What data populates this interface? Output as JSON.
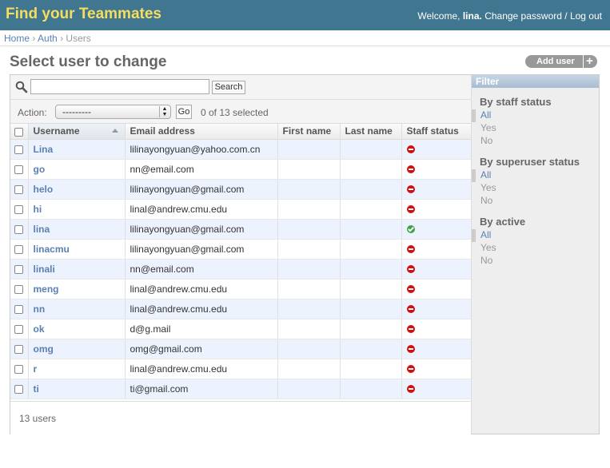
{
  "header": {
    "branding": "Find your Teammates",
    "welcome_prefix": "Welcome,",
    "username": "lina.",
    "change_password": "Change password",
    "separator": "/",
    "logout": "Log out"
  },
  "breadcrumbs": {
    "home": "Home",
    "sep": "›",
    "auth": "Auth",
    "current": "Users"
  },
  "page": {
    "title": "Select user to change",
    "add_user": "Add user"
  },
  "search": {
    "value": "",
    "placeholder": "",
    "button": "Search"
  },
  "actions": {
    "label": "Action:",
    "selected_option": "---------",
    "go": "Go",
    "counter": "0 of 13 selected"
  },
  "table": {
    "columns": [
      "Username",
      "Email address",
      "First name",
      "Last name",
      "Staff status"
    ],
    "rows": [
      {
        "username": "Lina",
        "email": "lilinayongyuan@yahoo.com.cn",
        "first_name": "",
        "last_name": "",
        "staff": false
      },
      {
        "username": "go",
        "email": "nn@email.com",
        "first_name": "",
        "last_name": "",
        "staff": false
      },
      {
        "username": "helo",
        "email": "lilinayongyuan@gmail.com",
        "first_name": "",
        "last_name": "",
        "staff": false
      },
      {
        "username": "hi",
        "email": "linal@andrew.cmu.edu",
        "first_name": "",
        "last_name": "",
        "staff": false
      },
      {
        "username": "lina",
        "email": "lilinayongyuan@gmail.com",
        "first_name": "",
        "last_name": "",
        "staff": true
      },
      {
        "username": "linacmu",
        "email": "lilinayongyuan@gmail.com",
        "first_name": "",
        "last_name": "",
        "staff": false
      },
      {
        "username": "linali",
        "email": "nn@email.com",
        "first_name": "",
        "last_name": "",
        "staff": false
      },
      {
        "username": "meng",
        "email": "linal@andrew.cmu.edu",
        "first_name": "",
        "last_name": "",
        "staff": false
      },
      {
        "username": "nn",
        "email": "linal@andrew.cmu.edu",
        "first_name": "",
        "last_name": "",
        "staff": false
      },
      {
        "username": "ok",
        "email": "d@g.mail",
        "first_name": "",
        "last_name": "",
        "staff": false
      },
      {
        "username": "omg",
        "email": "omg@gmail.com",
        "first_name": "",
        "last_name": "",
        "staff": false
      },
      {
        "username": "r",
        "email": "linal@andrew.cmu.edu",
        "first_name": "",
        "last_name": "",
        "staff": false
      },
      {
        "username": "ti",
        "email": "ti@gmail.com",
        "first_name": "",
        "last_name": "",
        "staff": false
      }
    ]
  },
  "paginator": "13 users",
  "filter": {
    "title": "Filter",
    "groups": [
      {
        "heading": "By staff status",
        "options": [
          "All",
          "Yes",
          "No"
        ],
        "selected": "All"
      },
      {
        "heading": "By superuser status",
        "options": [
          "All",
          "Yes",
          "No"
        ],
        "selected": "All"
      },
      {
        "heading": "By active",
        "options": [
          "All",
          "Yes",
          "No"
        ],
        "selected": "All"
      }
    ]
  },
  "colors": {
    "header_bg": "#417690",
    "branding": "#f5dd5d",
    "link": "#5b80b2",
    "row_alt": "#edf3fe",
    "staff_no": "#d10f0f",
    "staff_yes": "#3fa142"
  }
}
